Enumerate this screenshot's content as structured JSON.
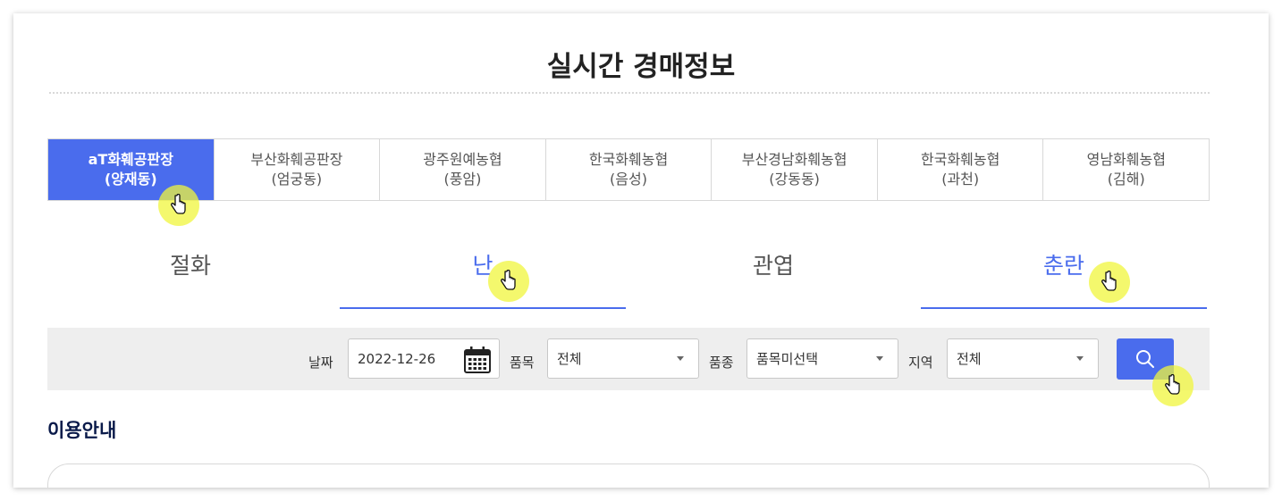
{
  "page": {
    "title": "실시간 경매정보"
  },
  "markets": [
    {
      "line1": "aT화훼공판장",
      "line2": "(양재동)",
      "active": true
    },
    {
      "line1": "부산화훼공판장",
      "line2": "(엄궁동)"
    },
    {
      "line1": "광주원예농협",
      "line2": "(풍암)"
    },
    {
      "line1": "한국화훼농협",
      "line2": "(음성)"
    },
    {
      "line1": "부산경남화훼농협",
      "line2": "(강동동)"
    },
    {
      "line1": "한국화훼농협",
      "line2": "(과천)"
    },
    {
      "line1": "영남화훼농협",
      "line2": "(김해)"
    }
  ],
  "categories": [
    {
      "label": "절화",
      "selected": false
    },
    {
      "label": "난",
      "selected": true
    },
    {
      "label": "관엽",
      "selected": false
    },
    {
      "label": "춘란",
      "selected": true
    }
  ],
  "search": {
    "date_label": "날짜",
    "date_value": "2022-12-26",
    "item_label": "품목",
    "item_value": "전체",
    "variety_label": "품종",
    "variety_value": "품목미선택",
    "region_label": "지역",
    "region_value": "전체",
    "button_icon": "search-icon"
  },
  "guide": {
    "title": "이용안내"
  },
  "colors": {
    "accent": "#4a6ced",
    "highlight": "#f0f53c"
  }
}
